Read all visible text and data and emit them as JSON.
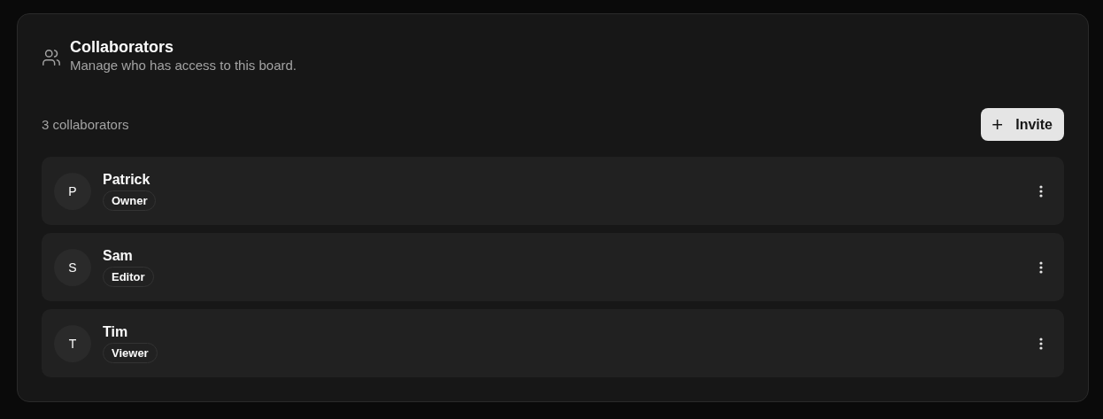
{
  "header": {
    "title": "Collaborators",
    "subtitle": "Manage who has access to this board."
  },
  "count": "3 collaborators",
  "invite_button": {
    "icon": "+",
    "label": "Invite"
  },
  "collaborators": [
    {
      "initial": "P",
      "name": "Patrick",
      "role": "Owner"
    },
    {
      "initial": "S",
      "name": "Sam",
      "role": "Editor"
    },
    {
      "initial": "T",
      "name": "Tim",
      "role": "Viewer"
    }
  ]
}
